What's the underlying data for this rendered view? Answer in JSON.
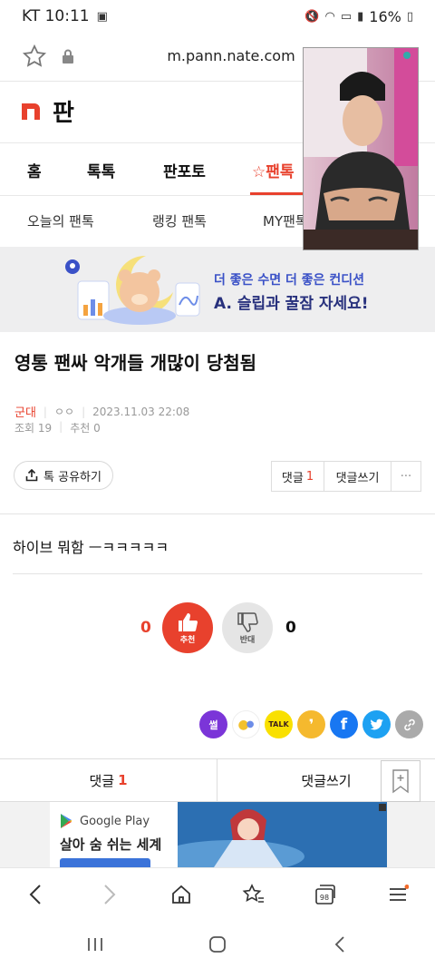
{
  "status_bar": {
    "carrier_time": "KT 10:11",
    "battery": "16%"
  },
  "browser": {
    "url": "m.pann.nate.com"
  },
  "site": {
    "logo_text": "판"
  },
  "main_nav": {
    "items": [
      "홈",
      "톡톡",
      "판포토",
      "팬톡"
    ],
    "active_index": 3
  },
  "sub_nav": {
    "items": [
      "오늘의 팬톡",
      "랭킹 팬톡",
      "MY팬톡"
    ]
  },
  "banner": {
    "line1": "더 좋은 수면 더 좋은 컨디션",
    "line2": "A. 슬립과 꿀잠 자세요!"
  },
  "article": {
    "title": "영통 팬싸 악개들 개많이 당첨됨",
    "category": "군대",
    "author": "ㅇㅇ",
    "date": "2023.11.03 22:08",
    "views": "조회 19",
    "recommends": "추천 0",
    "body": "하이브 뭐함 ㅡㅋㅋㅋㅋㅋ"
  },
  "actions": {
    "share_label": "톡 공유하기",
    "comments_label": "댓글",
    "comments_count": "1",
    "write_comment_label": "댓글쓰기",
    "more_label": "···"
  },
  "vote": {
    "up_count": "0",
    "up_label": "추천",
    "down_label": "반대",
    "down_count": "0"
  },
  "sns": [
    "썰",
    "TALK"
  ],
  "comment_bar": {
    "comments_label": "댓글",
    "comments_count": "1",
    "write_label": "댓글쓰기"
  },
  "ad": {
    "store": "Google Play",
    "text": "살아 숨 쉬는 세계"
  },
  "browser_nav": {
    "tabs_count": "98"
  },
  "colors": {
    "accent": "#e8412d",
    "banner_blue": "#3a51c7"
  }
}
